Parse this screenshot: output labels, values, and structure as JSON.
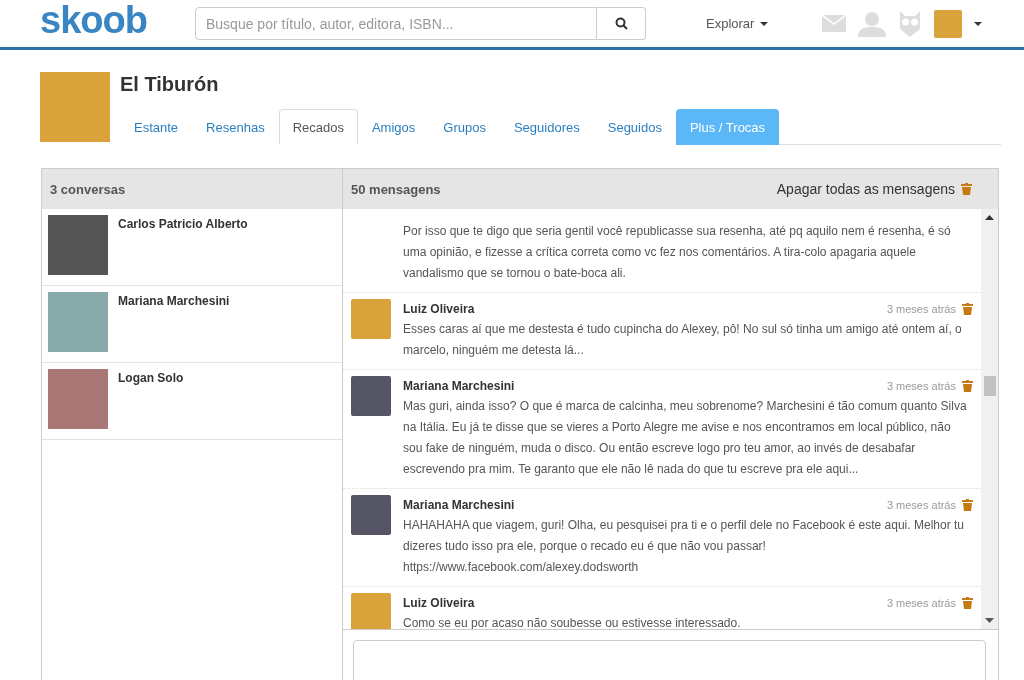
{
  "header": {
    "logo": "skoob",
    "search": {
      "placeholder": "Busque por título, autor, editora, ISBN..."
    },
    "explore": "Explorar"
  },
  "profile": {
    "name": "El Tiburón"
  },
  "tabs": [
    {
      "label": "Estante",
      "selected": false,
      "kind": "normal"
    },
    {
      "label": "Resenhas",
      "selected": false,
      "kind": "normal"
    },
    {
      "label": "Recados",
      "selected": true,
      "kind": "normal"
    },
    {
      "label": "Amigos",
      "selected": false,
      "kind": "normal"
    },
    {
      "label": "Grupos",
      "selected": false,
      "kind": "normal"
    },
    {
      "label": "Seguidores",
      "selected": false,
      "kind": "normal"
    },
    {
      "label": "Seguidos",
      "selected": false,
      "kind": "normal"
    },
    {
      "label": "Plus / Trocas",
      "selected": false,
      "kind": "highlight"
    }
  ],
  "conversations": {
    "title": "3 conversas",
    "items": [
      {
        "name": "Carlos Patricio Alberto"
      },
      {
        "name": "Mariana Marchesini"
      },
      {
        "name": "Logan Solo"
      }
    ]
  },
  "messages": {
    "title": "50 mensagens",
    "delete_all": "Apagar todas as mensagens",
    "items": [
      {
        "kind": "continuation",
        "lines": [
          "Por isso que te digo que seria gentil você republicasse sua resenha, até pq aquilo nem é resenha, é só uma opinião, e fizesse a crítica correta como vc fez nos comentários. A tira-colo apagaria aquele vandalismo que se tornou o bate-boca ali."
        ]
      },
      {
        "kind": "message",
        "author": "Luiz Oliveira",
        "time": "3 meses atrás",
        "lines": [
          "Esses caras aí que me destesta é tudo cupincha do Alexey, pô! No sul só tinha um amigo até ontem aí, o marcelo, ninguém me detesta lá..."
        ]
      },
      {
        "kind": "message",
        "author": "Mariana Marchesini",
        "time": "3 meses atrás",
        "lines": [
          "Mas guri, ainda isso? O que é marca de calcinha, meu sobrenome? Marchesini é tão comum quanto Silva na Itália. Eu já te disse que se vieres a Porto Alegre me avise e nos encontramos em local público, não sou fake de ninguém, muda o disco. Ou então escreve logo pro teu amor, ao invés de desabafar escrevendo pra mim. Te garanto que ele não lê nada do que tu escreve pra ele aqui..."
        ]
      },
      {
        "kind": "message",
        "author": "Mariana Marchesini",
        "time": "3 meses atrás",
        "lines": [
          "HAHAHAHA que viagem, guri! Olha, eu pesquisei pra ti e o perfil dele no Facebook é este aqui. Melhor tu dizeres tudo isso pra ele, porque o recado eu é que não vou passar!",
          "https://www.facebook.com/alexey.dodsworth"
        ]
      },
      {
        "kind": "message",
        "author": "Luiz Oliveira",
        "time": "3 meses atrás",
        "lines": [
          "Como se eu por acaso não soubesse ou estivesse interessado."
        ]
      }
    ]
  }
}
